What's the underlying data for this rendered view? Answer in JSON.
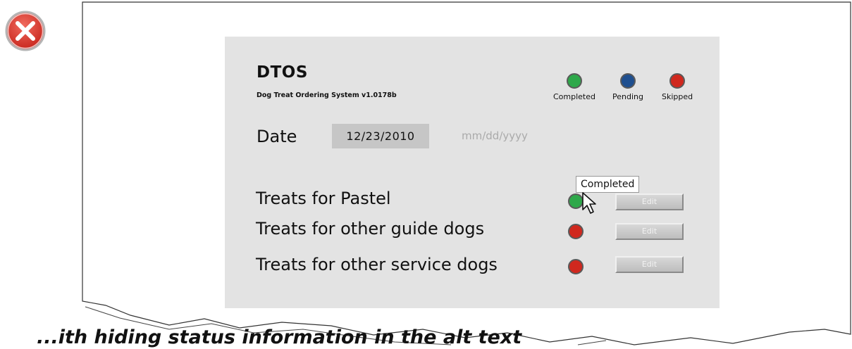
{
  "app": {
    "title": "DTOS",
    "subtitle": "Dog Treat Ordering System v1.0178b"
  },
  "legend": [
    {
      "label": "Completed",
      "color": "#2ea84a"
    },
    {
      "label": "Pending",
      "color": "#1f4f8f"
    },
    {
      "label": "Skipped",
      "color": "#d0281e"
    }
  ],
  "date": {
    "label": "Date",
    "value": "12/23/2010",
    "format_hint": "mm/dd/yyyy"
  },
  "tasks": [
    {
      "label": "Treats for Pastel",
      "status": "Completed",
      "status_color": "#2ea84a",
      "edit_label": "Edit"
    },
    {
      "label": "Treats for other guide dogs",
      "status": "Skipped",
      "status_color": "#d0281e",
      "edit_label": "Edit"
    },
    {
      "label": "Treats for other service dogs",
      "status": "Skipped",
      "status_color": "#d0281e",
      "edit_label": "Edit"
    }
  ],
  "tooltip": {
    "text": "Completed"
  },
  "icons": {
    "bad_example": "red-x-circle-icon",
    "pointer": "mouse-pointer-icon"
  },
  "caption": "...ith hiding status information in the alt text"
}
